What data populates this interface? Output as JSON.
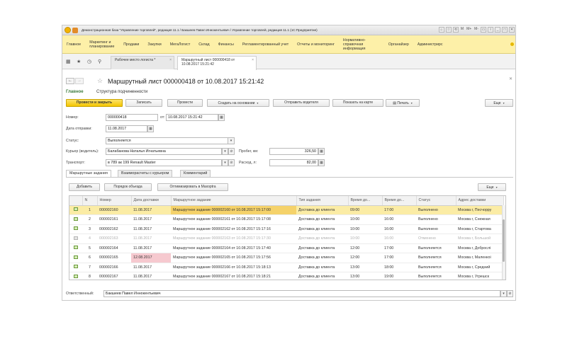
{
  "titlebar": {
    "title": "Демонстрационная база \"Управление торговлей\", редакция 11.1 / Бакшеев Павел Иннокентьевич / Управление торговлей, редакция 11.1 (1С:Предприятие)",
    "tools": [
      "M",
      "M+",
      "M-"
    ]
  },
  "menu": {
    "items": [
      "Главное",
      "Маркетинг и планирование",
      "Продажи",
      "Закупки",
      "МегаЛогист",
      "Склад",
      "Финансы",
      "Регламентированный учет",
      "Отчеты и мониторинг",
      "Нормативно-справочная информация",
      "Органайзер",
      "Администрирс"
    ]
  },
  "tabs": {
    "t1": "Рабочее место логиста *",
    "t2": "Маршрутный лист 000000418 от 10.08.2017 15:21:42"
  },
  "form": {
    "title": "Маршрутный лист 000000418 от 10.08.2017 15:21:42",
    "nav_main": "Главное",
    "nav_structure": "Структура подчиненности",
    "buttons": {
      "post_close": "Провести и закрыть",
      "save": "Записать",
      "post": "Провести",
      "create_based": "Создать на основании",
      "send_driver": "Отправить водителя",
      "show_map": "Показать на карте",
      "print": "Печать",
      "more": "Еще"
    },
    "fields": {
      "number_label": "Номер:",
      "number": "000000418",
      "from_label": "от:",
      "date": "10.08.2017 15:21:42",
      "ship_label": "Дата отправки:",
      "ship_date": "11.08.2017",
      "status_label": "Статус:",
      "status": "Выполняется",
      "courier_label": "Курьер (водитель):",
      "courier": "Балабанова Наталья Игнатьевна",
      "mileage_label": "Пробег, км:",
      "mileage": "326,50",
      "transport_label": "Транспорт:",
      "transport": "в 789 ак 199 Renault Master",
      "cost_label": "Расход, л:",
      "cost": "82,00"
    },
    "section_tabs": [
      "Маршрутные задания",
      "Взаиморасчеты с курьером",
      "Комментарий"
    ],
    "table_buttons": {
      "add": "Добавить",
      "order": "Порядок объезда",
      "optimize": "Оптимизировать в Maxoptra",
      "more": "Еще"
    },
    "columns": [
      "N",
      "Номер",
      "Дата доставки",
      "Маршрутное задание",
      "Тип задания",
      "Время до...",
      "Время до...",
      "Статус",
      "Адрес доставки"
    ],
    "rows": [
      {
        "n": "1",
        "num": "000002160",
        "date": "11.08.2017",
        "task": "Маршрутное задание 000002160 от 10.08.2017 15:17:00",
        "type": "Доставка до клиента",
        "t1": "09:00",
        "t2": "17:00",
        "status": "Выполнено",
        "addr": "Москва г, Песчорру"
      },
      {
        "n": "2",
        "num": "000002161",
        "date": "11.08.2017",
        "task": "Маршрутное задание 000002161 от 10.08.2017 15:17:08",
        "type": "Доставка до клиента",
        "t1": "10:00",
        "t2": "16:00",
        "status": "Выполнено",
        "addr": "Москва г, Снежная"
      },
      {
        "n": "3",
        "num": "000002162",
        "date": "11.08.2017",
        "task": "Маршрутное задание 000002162 от 10.08.2017 15:17:16",
        "type": "Доставка до клиента",
        "t1": "10:00",
        "t2": "16:00",
        "status": "Выполнено",
        "addr": "Москва г, Стартова"
      },
      {
        "n": "4",
        "num": "000002163",
        "date": "11.08.2017",
        "task": "Маршрутное задание 000002163 от 10.08.2017 15:17:30",
        "type": "Доставка до клиента",
        "t1": "10:00",
        "t2": "16:00",
        "status": "Отменено",
        "addr": "Москва г, Большой"
      },
      {
        "n": "5",
        "num": "000002164",
        "date": "11.08.2017",
        "task": "Маршрутное задание 000002164 от 10.08.2017 15:17:40",
        "type": "Доставка до клиента",
        "t1": "12:00",
        "t2": "17:00",
        "status": "Выполняется",
        "addr": "Москва г, Доброслі"
      },
      {
        "n": "6",
        "num": "000002165",
        "date": "12.08.2017",
        "task": "Маршрутное задание 000002165 от 10.08.2017 15:17:56",
        "type": "Доставка до клиента",
        "t1": "12:00",
        "t2": "17:00",
        "status": "Выполняется",
        "addr": "Москва г, Маленкоі"
      },
      {
        "n": "7",
        "num": "000002166",
        "date": "11.08.2017",
        "task": "Маршрутное задание 000002166 от 10.08.2017 15:18:13",
        "type": "Доставка до клиента",
        "t1": "13:00",
        "t2": "18:00",
        "status": "Выполняется",
        "addr": "Москва г, Средний"
      },
      {
        "n": "8",
        "num": "000002167",
        "date": "11.08.2017",
        "task": "Маршрутное задание 000002167 от 10.08.2017 15:18:21",
        "type": "Доставка до клиента",
        "t1": "13:00",
        "t2": "19:00",
        "status": "Выполняется",
        "addr": "Москва г, Угрешск"
      }
    ],
    "responsible_label": "Ответственный:",
    "responsible": "Бакшеев Павел Иннокентьевич"
  },
  "colors": {
    "menu_bg": "#fdf0a8",
    "primary_button": "#f3c500",
    "selected_row": "#fbeca5",
    "highlight_cell": "#f6c9cf"
  }
}
